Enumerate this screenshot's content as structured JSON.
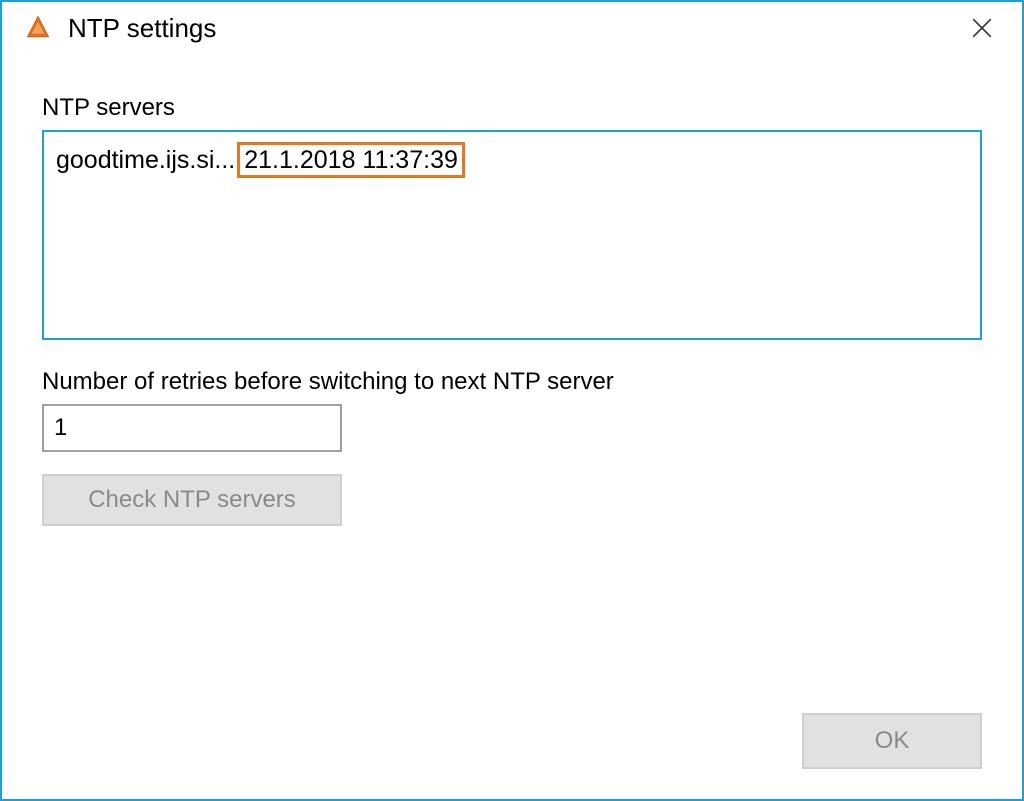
{
  "window": {
    "title": "NTP settings"
  },
  "labels": {
    "servers": "NTP servers",
    "retries": "Number of retries before switching to next NTP server"
  },
  "servers": [
    {
      "name": "goodtime.ijs.si...",
      "timestamp": "21.1.2018 11:37:39"
    }
  ],
  "retries_value": "1",
  "buttons": {
    "check": "Check NTP servers",
    "ok": "OK"
  }
}
